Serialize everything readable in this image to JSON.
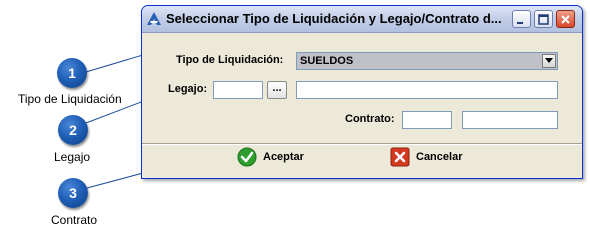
{
  "window": {
    "title": "Seleccionar Tipo de Liquidación y Legajo/Contrato d..."
  },
  "form": {
    "tipo_label": "Tipo de Liquidación:",
    "tipo_value": "SUELDOS",
    "legajo_label": "Legajo:",
    "legajo_value": "",
    "legajo_desc_value": "",
    "browse_label": "...",
    "contrato_label": "Contrato:",
    "contrato_value": "",
    "contrato_desc_value": ""
  },
  "buttons": {
    "accept": "Aceptar",
    "cancel": "Cancelar"
  },
  "callouts": [
    {
      "number": "1",
      "caption": "Tipo de Liquidación"
    },
    {
      "number": "2",
      "caption": "Legajo"
    },
    {
      "number": "3",
      "caption": "Contrato"
    }
  ],
  "colors": {
    "callout": "#1f5fb6",
    "accept": "#2e9e2e",
    "cancel": "#d63a1e"
  }
}
